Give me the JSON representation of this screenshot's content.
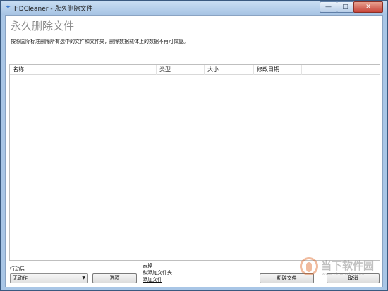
{
  "window": {
    "title": "HDCleaner - 永久删除文件",
    "app_icon": "hdcleaner-icon",
    "controls": {
      "minimize": "—",
      "maximize": "□",
      "close": "✕"
    }
  },
  "page": {
    "heading": "永久删除文件",
    "description": "按照国际标准删除所有选中的文件和文件夹，删除数据载体上的数据不再可恢复。"
  },
  "file_list": {
    "columns": [
      "名称",
      "类型",
      "大小",
      "修改日期"
    ],
    "rows": []
  },
  "footer": {
    "action_label": "行动后",
    "action_select_value": "无动作",
    "options_button": "选项",
    "links": {
      "remove": "去掉",
      "add_folder": "和添加文件夹",
      "add_file": "添加文件"
    },
    "shred_button": "粉碎文件",
    "cancel_button": "取消"
  },
  "watermark": {
    "text": "当下软件园",
    "url": "www.downxia.com",
    "logo_color": "#e06a2a"
  }
}
